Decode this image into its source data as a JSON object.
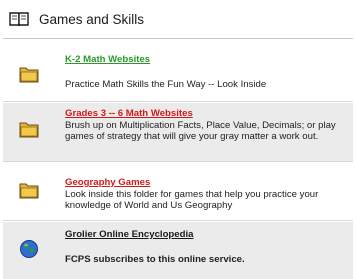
{
  "header": {
    "title": "Games and Skills",
    "icon": "book-icon"
  },
  "items": [
    {
      "icon": "folder-icon",
      "title": "K-2 Math Websites",
      "description": "Practice Math Skills the Fun Way -- Look Inside",
      "link_color": "#2b9a2b"
    },
    {
      "icon": "folder-icon",
      "title": "Grades 3 -- 6 Math Websites",
      "description": "Brush up on Multiplication Facts, Place Value, Decimals; or play games of strategy that will give your gray matter a work out.",
      "link_color": "#d21a1a"
    },
    {
      "icon": "folder-icon",
      "title": "Geography Games",
      "description": "Look inside this folder for games that help you practice your knowledge of World and Us Geography",
      "link_color": "#d21a1a"
    },
    {
      "icon": "globe-icon",
      "title": "Grolier Online Encyclopedia",
      "description": "FCPS subscribes to this online service.",
      "link_color": "#1a1a1a"
    }
  ]
}
